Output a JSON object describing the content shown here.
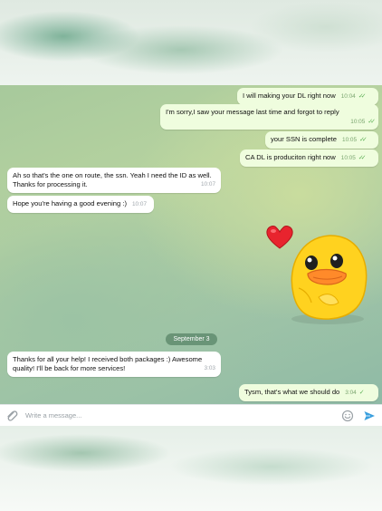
{
  "messages_out_top": [
    {
      "text": "I will making your DL right now",
      "time": "10:04"
    },
    {
      "text": "I'm sorry,I saw your message last time and forgot to reply",
      "time": "10:05"
    },
    {
      "text": "your SSN is complete",
      "time": "10:05"
    },
    {
      "text": "CA DL is produciton right now",
      "time": "10:05"
    }
  ],
  "messages_in": [
    {
      "line1": "Ah so that's the one on route, the ssn. Yeah I need the ID as well.",
      "line2": "Thanks for processing it.",
      "time": "10:07"
    },
    {
      "text": "Hope you're having a good evening :)",
      "time": "10:07"
    }
  ],
  "date_separator": "September 3",
  "message_in_sept": {
    "line1": "Thanks for all your help! I received both packages :) Awesome",
    "line2": "quality! I'll be back for more services!",
    "time": "3:03"
  },
  "message_out_last": {
    "text": "Tysm, that's what we should do",
    "time": "3:04"
  },
  "composer": {
    "placeholder": "Write a message..."
  },
  "icons": {
    "attach": "paperclip-icon",
    "emoji": "smiley-icon",
    "send": "send-arrow-icon",
    "read_receipt": "double-check-icon"
  },
  "colors": {
    "outgoing_bubble": "#effdde",
    "incoming_bubble": "#ffffff",
    "send_accent": "#3a9fde",
    "check_green": "#5fb157"
  }
}
